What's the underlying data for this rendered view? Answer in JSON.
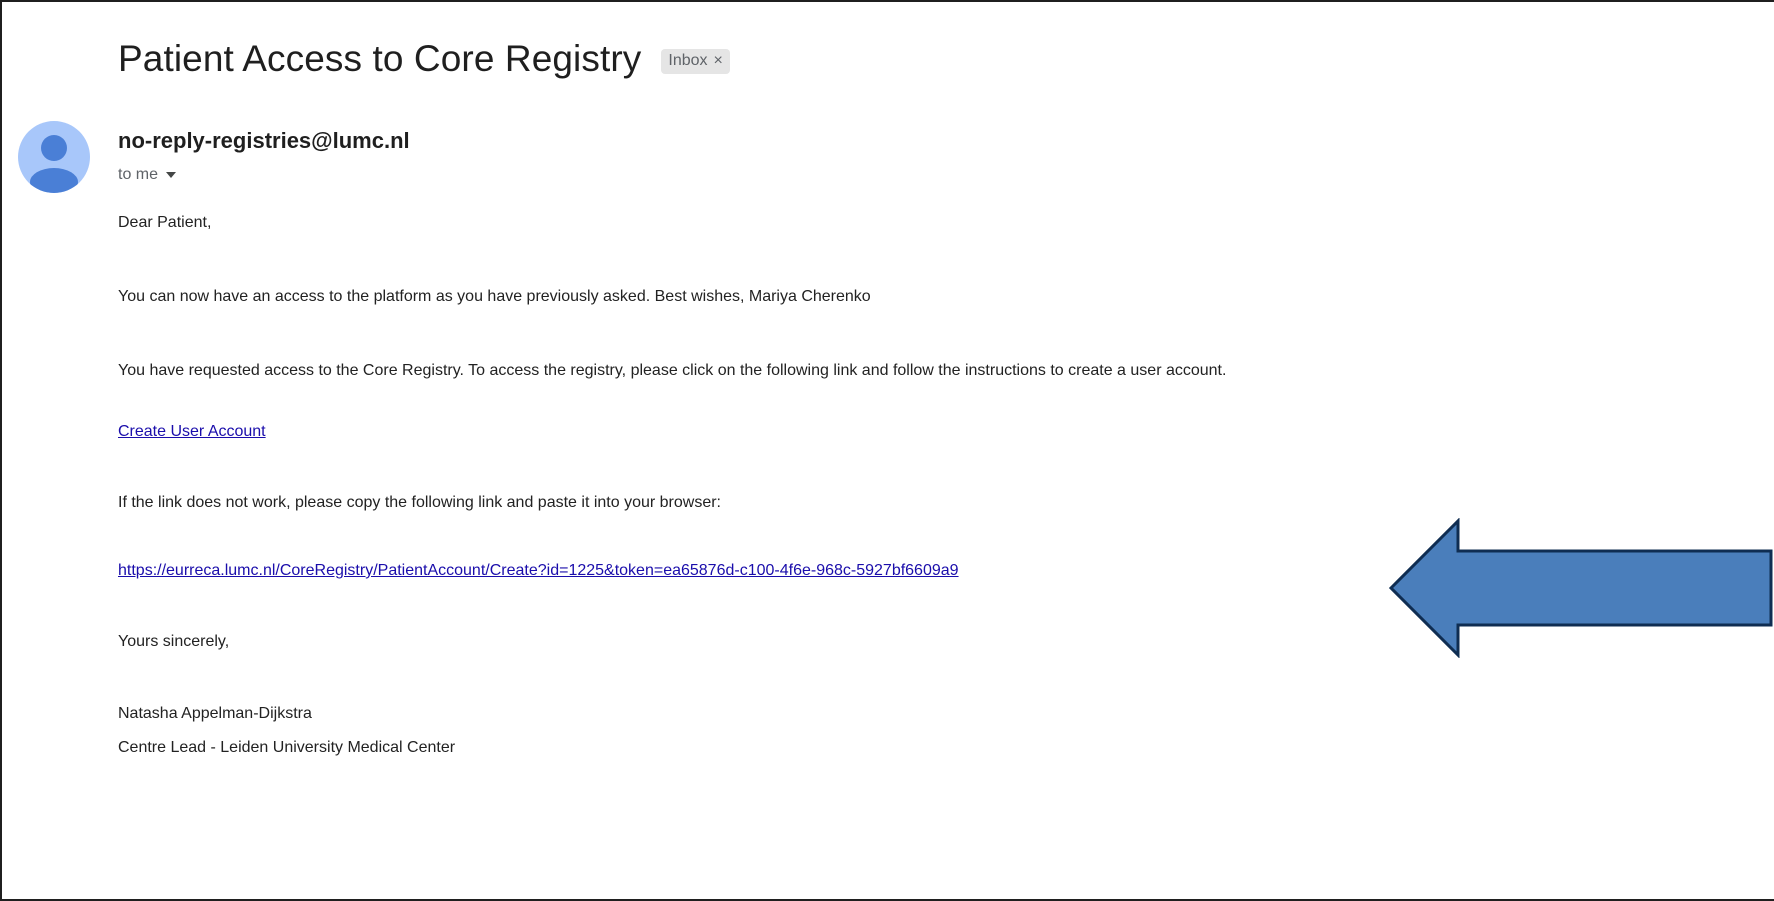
{
  "email": {
    "subject": "Patient Access to Core Registry",
    "label_chip": "Inbox",
    "label_chip_close": "×",
    "sender": "no-reply-registries@lumc.nl",
    "recipient": "to me",
    "greeting": "Dear Patient,",
    "paragraph_1": "You can now have an access to the platform as you have previously asked. Best wishes, Mariya Cherenko",
    "paragraph_2": "You have requested access to the Core Registry. To access the registry, please click on the following link and follow the instructions to create a user account.",
    "create_link_text": "Create User Account",
    "fallback_text": "If the link does not work, please copy the following link and paste it into your browser:",
    "full_link": "https://eurreca.lumc.nl/CoreRegistry/PatientAccount/Create?id=1225&token=ea65876d-c100-4f6e-968c-5927bf6609a9",
    "closing": "Yours sincerely,",
    "signature_name": "Natasha Appelman-Dijkstra",
    "signature_title": "Centre Lead - Leiden University Medical Center"
  },
  "icons": {
    "avatar": "person-avatar-icon",
    "recipient_toggle": "chevron-down-icon",
    "annotation": "left-arrow-icon"
  },
  "colors": {
    "avatar_bg": "#a8c7fa",
    "avatar_fg": "#4a7fd6",
    "link": "#1a0dab",
    "arrow_fill": "#4a7ebb",
    "arrow_stroke": "#0f2d52",
    "chip_bg": "#e5e5e5"
  }
}
